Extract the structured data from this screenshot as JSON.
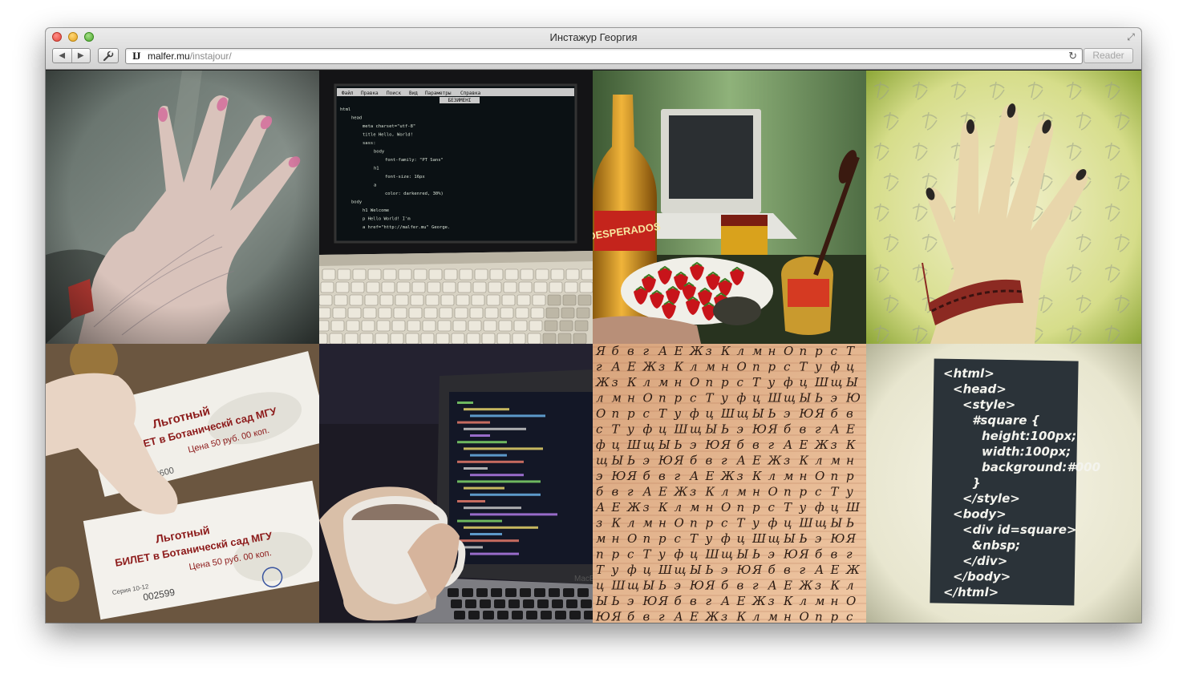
{
  "window": {
    "title": "Инстажур Георгия",
    "address": {
      "favicon": "IJ",
      "domain": "malfer.mu",
      "path": "/instajour/"
    },
    "reader_label": "Reader"
  },
  "icons": {
    "back": "◀",
    "forward": "▶",
    "tools": "wrench-icon",
    "reload": "↻",
    "fullscreen": "⤢"
  },
  "photos": {
    "editor_menu": [
      "Файл",
      "Правка",
      "Поиск",
      "Вид",
      "Параметры",
      "Справка"
    ],
    "editor_tab": "БЕЗИМЕНІ",
    "editor_code": [
      "html",
      "  head",
      "    meta charset=\"utf-8\"",
      "    title Hello, World!",
      "    sass:",
      "      body",
      "        font-family: \"PT Sans\"",
      "      h1",
      "        font-size: 16px",
      "      a",
      "        color: darkenred, 30%)",
      "  body",
      "    h1 Welcome",
      "    p Hello World! I'm",
      "    a href=\"http://malfer.mu\" George."
    ],
    "bottle_label": "DESPERADOS",
    "ticket_lines": [
      "Льготный",
      "БИЛЕТ в Ботаническй сад МГУ",
      "Цена 50 руб. 00 коп."
    ],
    "ticket_series": "Серия 10-12",
    "ticket_number": "002599",
    "ticket_number_top": "002600",
    "laptop_brand": "MacBook",
    "chalk_code": [
      "<html>",
      "  <head>",
      "    <style>",
      "      #square {",
      "        height:100px;",
      "        width:100px;",
      "        background:#000",
      "      }",
      "    </style>",
      "  <body>",
      "    <div id=square>",
      "      &nbsp;",
      "    </div>",
      "  </body>",
      "</html>"
    ]
  }
}
